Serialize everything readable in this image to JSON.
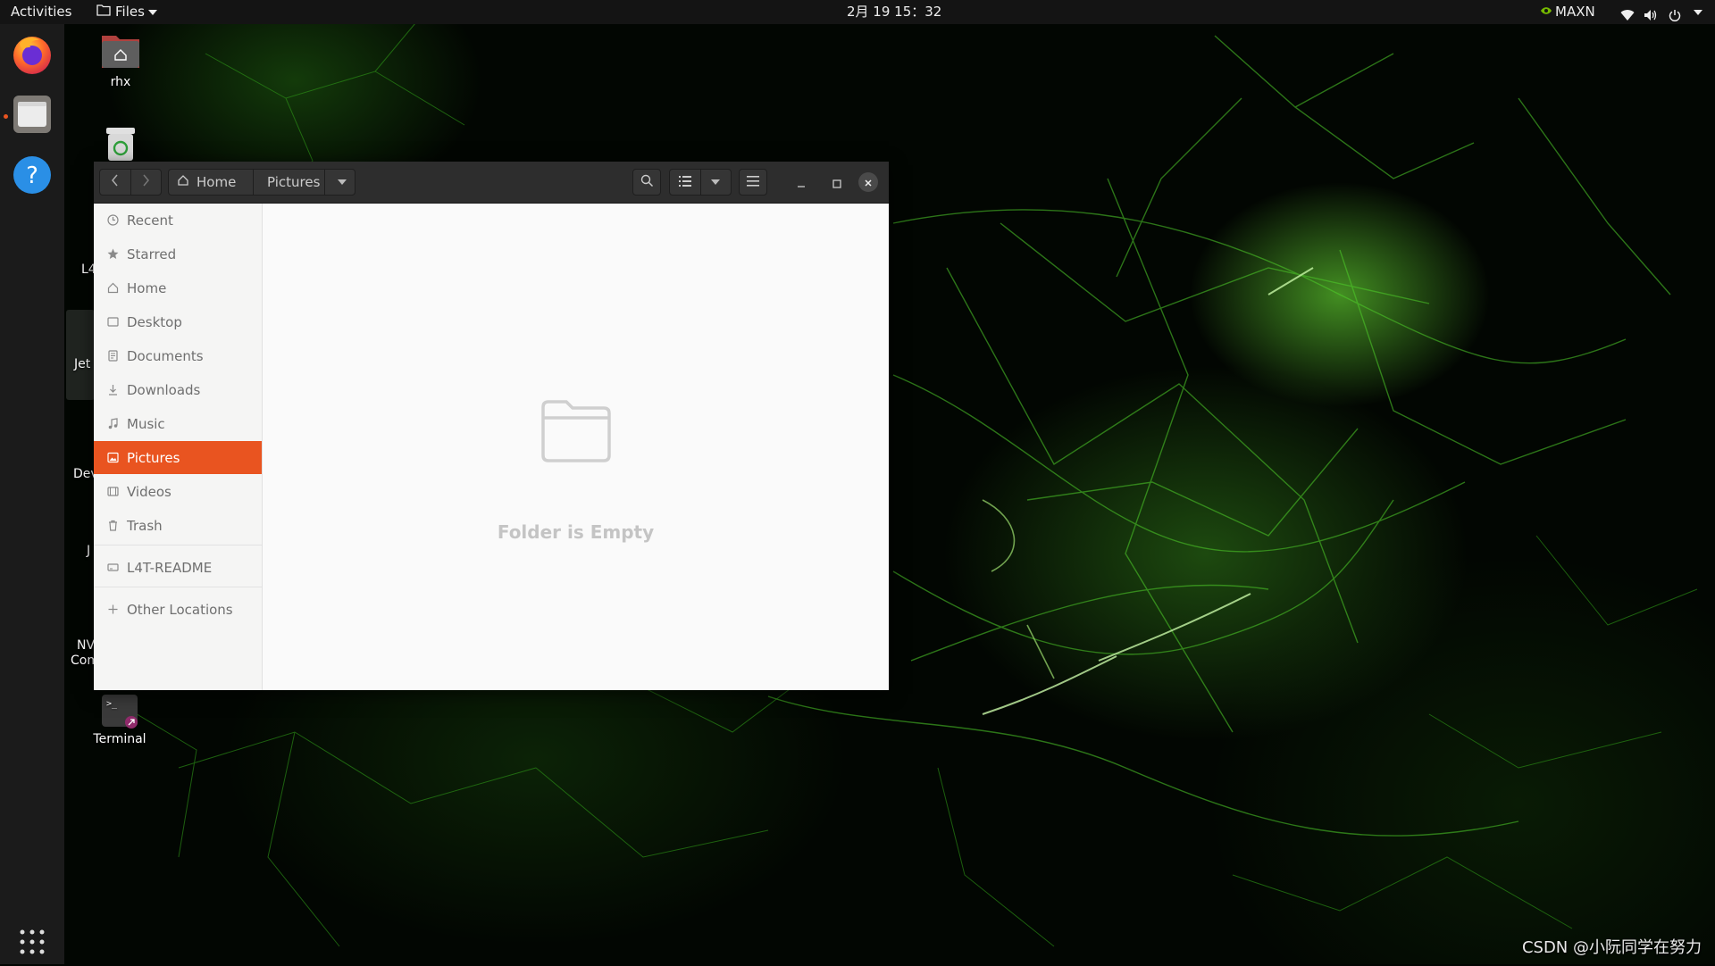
{
  "topbar": {
    "activities": "Activities",
    "app_menu": "Files",
    "clock": "2月 19  15：32",
    "power_mode": "MAXN"
  },
  "dock": {
    "items": [
      {
        "name": "Firefox",
        "icon": "firefox-icon"
      },
      {
        "name": "Files",
        "icon": "files-icon",
        "running": true
      },
      {
        "name": "Help",
        "icon": "help-icon"
      }
    ],
    "show_apps_icon": "app-grid-icon"
  },
  "desktop": {
    "icons": [
      {
        "label": "rhx",
        "icon": "home-folder-icon"
      },
      {
        "label": "",
        "icon": "trash-icon"
      },
      {
        "label": "Terminal",
        "icon": "terminal-icon"
      }
    ],
    "partial_labels": [
      "L4",
      "Jet",
      "Dev",
      "J",
      "NV",
      "Com"
    ]
  },
  "files_window": {
    "breadcrumb": [
      "Home",
      "Pictures"
    ],
    "sidebar": [
      {
        "label": "Recent",
        "icon": "clock-icon"
      },
      {
        "label": "Starred",
        "icon": "star-icon"
      },
      {
        "label": "Home",
        "icon": "home-icon"
      },
      {
        "label": "Desktop",
        "icon": "desktop-icon"
      },
      {
        "label": "Documents",
        "icon": "document-icon"
      },
      {
        "label": "Downloads",
        "icon": "download-icon"
      },
      {
        "label": "Music",
        "icon": "music-icon"
      },
      {
        "label": "Pictures",
        "icon": "picture-icon",
        "active": true
      },
      {
        "label": "Videos",
        "icon": "video-icon"
      },
      {
        "label": "Trash",
        "icon": "trash-icon"
      }
    ],
    "devices": [
      {
        "label": "L4T-README",
        "icon": "drive-icon"
      }
    ],
    "other": [
      {
        "label": "Other Locations",
        "icon": "plus-icon"
      }
    ],
    "empty_message": "Folder is Empty"
  },
  "watermark": "CSDN @小阮同学在努力",
  "colors": {
    "accent": "#e95420",
    "topbar": "#141414",
    "dock": "#1b1b1b",
    "headerbar": "#2d2d2d"
  }
}
